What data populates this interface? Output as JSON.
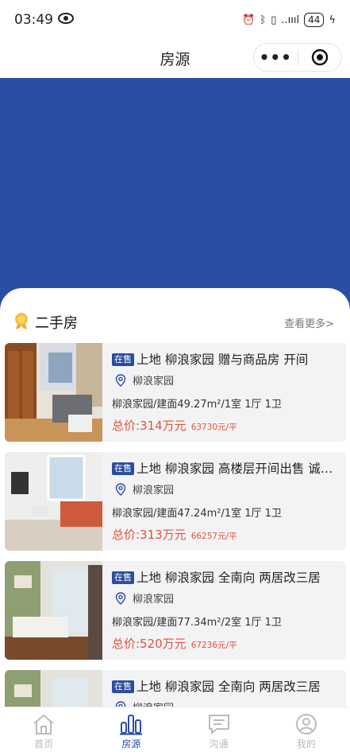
{
  "status": {
    "time": "03:49",
    "signal": "..ıııl",
    "battery": "44"
  },
  "header": {
    "title": "房源"
  },
  "section": {
    "title": "二手房",
    "see_more": "查看更多>"
  },
  "listings": [
    {
      "tag": "在售",
      "title": "上地 柳浪家园 赠与商品房 开间",
      "community": "柳浪家园",
      "spec": "柳浪家园/建面49.27m²/1室 1厅 1卫",
      "total": "总价:314万元",
      "unit_price": "63730元/平"
    },
    {
      "tag": "在售",
      "title": "上地 柳浪家园 高楼层开间出售 诚心出售",
      "community": "柳浪家园",
      "spec": "柳浪家园/建面47.24m²/1室 1厅 1卫",
      "total": "总价:313万元",
      "unit_price": "66257元/平"
    },
    {
      "tag": "在售",
      "title": "上地 柳浪家园 全南向 两居改三居",
      "community": "柳浪家园",
      "spec": "柳浪家园/建面77.34m²/2室 1厅 1卫",
      "total": "总价:520万元",
      "unit_price": "67236元/平"
    },
    {
      "tag": "在售",
      "title": "上地 柳浪家园 全南向 两居改三居",
      "community": "柳浪家园",
      "spec": "",
      "total": "",
      "unit_price": ""
    }
  ],
  "tabs": [
    {
      "label": "首页",
      "icon": "home-icon"
    },
    {
      "label": "房源",
      "icon": "bar-chart-icon"
    },
    {
      "label": "沟通",
      "icon": "chat-icon"
    },
    {
      "label": "我的",
      "icon": "user-icon"
    }
  ],
  "colors": {
    "brand": "#2a4ea2",
    "price": "#e4513a"
  }
}
